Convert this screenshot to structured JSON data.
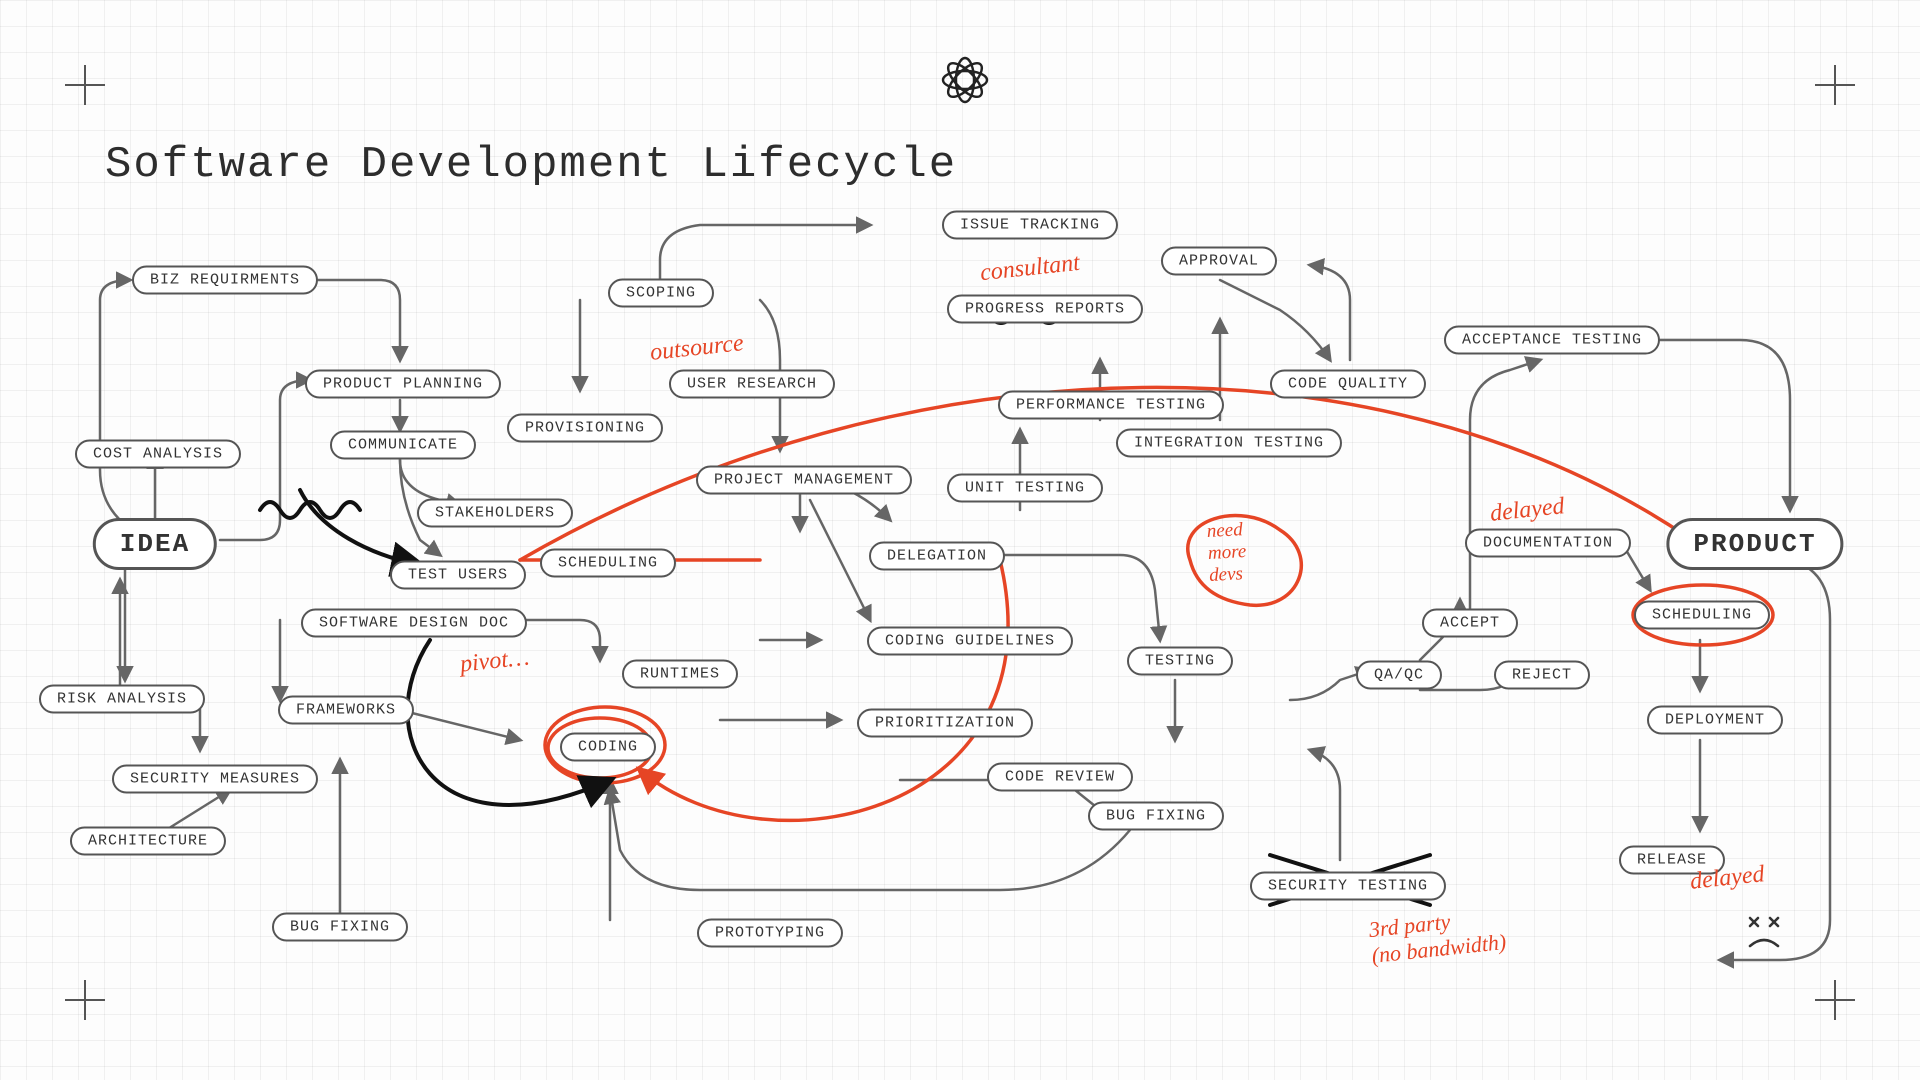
{
  "title": "Software Development Lifecycle",
  "annotations": {
    "consultant": "consultant",
    "outsource": "outsource",
    "pivot": "pivot…",
    "need_devs": "need\nmore\ndevs",
    "delayed_doc": "delayed",
    "delayed_rel": "delayed",
    "third_party": "3rd party\n(no bandwidth)"
  },
  "nodes": {
    "idea": "IDEA",
    "product": "PRODUCT",
    "biz_req": "BIZ REQUIRMENTS",
    "cost": "COST ANALYSIS",
    "risk": "RISK ANALYSIS",
    "security_meas": "SECURITY MEASURES",
    "architecture": "ARCHITECTURE",
    "product_plan": "PRODUCT PLANNING",
    "communicate": "COMMUNICATE",
    "stakeholders": "STAKEHOLDERS",
    "test_users": "TEST USERS",
    "sw_design": "SOFTWARE DESIGN DOC",
    "frameworks": "FRAMEWORKS",
    "bug_fixing_l": "BUG FIXING",
    "scoping": "SCOPING",
    "provisioning": "PROVISIONING",
    "user_research": "USER RESEARCH",
    "scheduling_l": "SCHEDULING",
    "project_mgmt": "PROJECT MANAGEMENT",
    "runtimes": "RUNTIMES",
    "coding": "CODING",
    "prototyping": "PROTOTYPING",
    "issue_track": "ISSUE TRACKING",
    "progress_rep": "PROGRESS REPORTS",
    "delegation": "DELEGATION",
    "unit_test": "UNIT TESTING",
    "coding_guide": "CODING GUIDELINES",
    "prioritization": "PRIORITIZATION",
    "code_review": "CODE REVIEW",
    "perf_test": "PERFORMANCE TESTING",
    "int_test": "INTEGRATION TESTING",
    "testing": "TESTING",
    "bug_fixing_r": "BUG FIXING",
    "sec_test": "SECURITY TESTING",
    "approval": "APPROVAL",
    "code_quality": "CODE QUALITY",
    "qaqc": "QA/QC",
    "accept": "ACCEPT",
    "reject": "REJECT",
    "accept_test": "ACCEPTANCE TESTING",
    "documentation": "DOCUMENTATION",
    "scheduling_r": "SCHEDULING",
    "deployment": "DEPLOYMENT",
    "release": "RELEASE"
  }
}
